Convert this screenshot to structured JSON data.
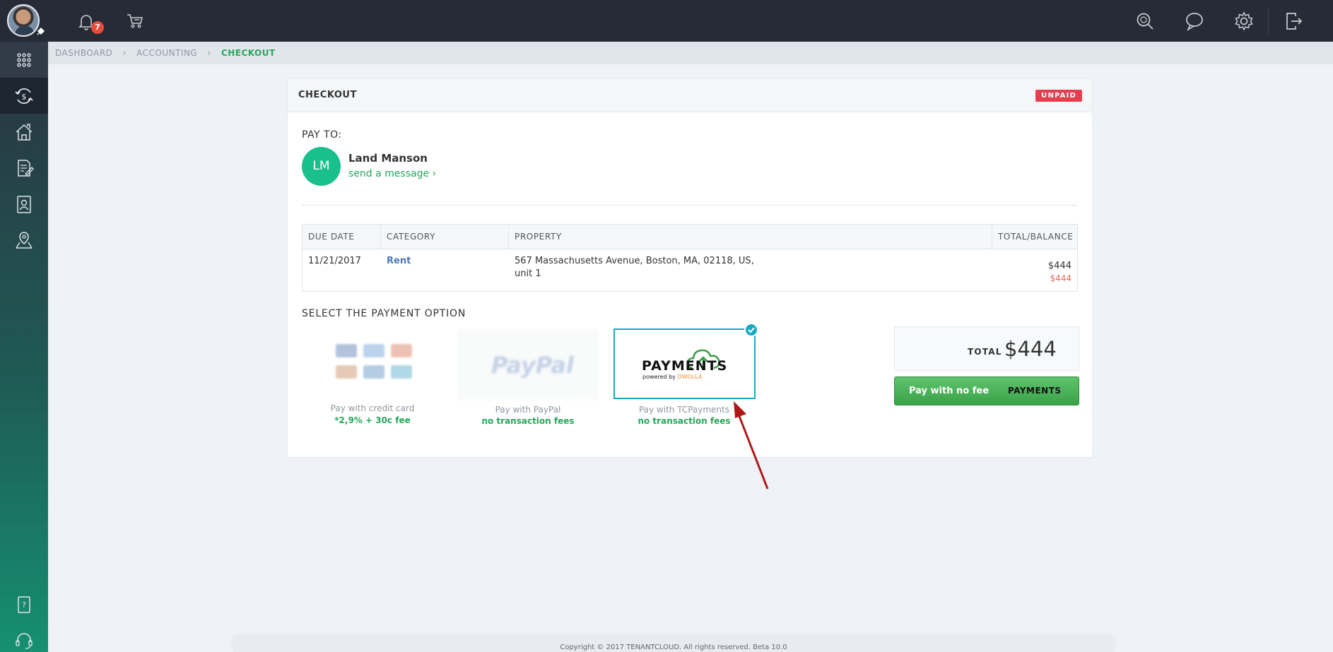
{
  "topbar": {
    "notifications_count": "7",
    "icons": [
      "user-avatar",
      "pin-icon",
      "bell-icon",
      "cart-icon",
      "search-icon",
      "chat-icon",
      "gear-icon",
      "logout-icon"
    ]
  },
  "sidebar": {
    "items": [
      {
        "name": "apps-grid-icon"
      },
      {
        "name": "accounting-icon"
      },
      {
        "name": "properties-icon"
      },
      {
        "name": "applications-icon"
      },
      {
        "name": "tenants-icon"
      },
      {
        "name": "map-pin-icon"
      },
      {
        "name": "help-icon"
      },
      {
        "name": "support-icon"
      }
    ]
  },
  "breadcrumb": {
    "items": [
      "DASHBOARD",
      "ACCOUNTING",
      "CHECKOUT"
    ]
  },
  "checkout": {
    "title": "CHECKOUT",
    "status": "UNPAID",
    "pay_to_label": "PAY TO:",
    "payee": {
      "initials": "LM",
      "name": "Land Manson",
      "message_link": "send a message ›"
    },
    "table": {
      "headers": [
        "DUE DATE",
        "CATEGORY",
        "PROPERTY",
        "TOTAL/BALANCE"
      ],
      "row": {
        "due_date": "11/21/2017",
        "category": "Rent",
        "property_line1": "567 Massachusetts Avenue, Boston, MA, 02118, US,",
        "property_line2": "unit 1",
        "total": "$444",
        "balance": "$444"
      }
    },
    "select_label": "SELECT THE PAYMENT OPTION",
    "options": {
      "credit_card": {
        "caption": "Pay with credit card",
        "note": "*2,9% + 30c fee"
      },
      "paypal": {
        "logo": "PayPal",
        "caption": "Pay with PayPal",
        "note": "no transaction fees"
      },
      "tcpayments": {
        "logo": "PAYMENTS",
        "sub_prefix": "powered by ",
        "sub_brand": "DWOLLA",
        "caption": "Pay with TCPayments",
        "note": "no transaction fees"
      }
    },
    "total_label": "TOTAL",
    "total_value": "$444",
    "pay_button_label": "Pay with no fee",
    "pay_button_logo": "PAYMENTS"
  },
  "footer": {
    "text": "Copyright © 2017 TENANTCLOUD. All rights reserved. Beta 10.0"
  },
  "colors": {
    "topbar": "#262b35",
    "accent_green": "#26a65b",
    "unpaid_red": "#e53f4f",
    "selected_border": "#18a9c4",
    "annotation_arrow": "#b01818"
  }
}
